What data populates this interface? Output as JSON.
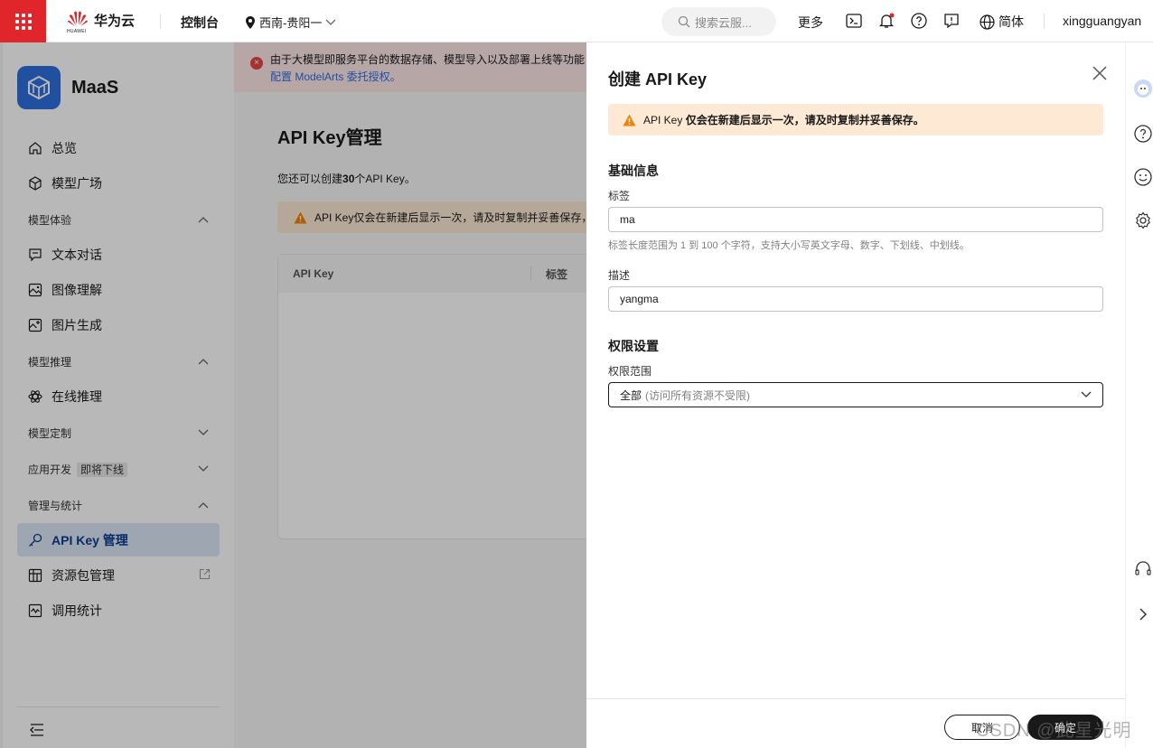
{
  "topbar": {
    "brand_name": "华为云",
    "brand_sub": "HUAWEI",
    "console": "控制台",
    "region": "西南-贵阳一",
    "search_placeholder": "搜索云服...",
    "more": "更多",
    "language": "简体",
    "username": "xingguangyan",
    "brand_color": "#e0262b"
  },
  "sidebar": {
    "product": "MaaS",
    "items_top": [
      {
        "label": "总览",
        "icon": "home-icon"
      },
      {
        "label": "模型广场",
        "icon": "model-cube-icon"
      }
    ],
    "group_experience": {
      "title": "模型体验",
      "items": [
        "文本对话",
        "图像理解",
        "图片生成"
      ]
    },
    "group_inference": {
      "title": "模型推理",
      "items": [
        "在线推理"
      ]
    },
    "group_custom": {
      "title": "模型定制"
    },
    "group_appdev": {
      "title": "应用开发",
      "tag": "即将下线"
    },
    "group_manage": {
      "title": "管理与统计",
      "items": [
        "API Key 管理",
        "资源包管理",
        "调用统计"
      ]
    }
  },
  "main": {
    "banner_text": "由于大模型即服务平台的数据存储、模型导入以及部署上线等功能",
    "banner_link": "配置 ModelArts 委托授权。",
    "page_title": "API Key管理",
    "remain_pre": "您还可以创建",
    "remain_count": "30",
    "remain_post": "个API Key。",
    "warn_text": "API Key仅会在新建后显示一次，请及时复制并妥善保存，",
    "table_headers": [
      "API Key",
      "标签"
    ]
  },
  "drawer": {
    "title": "创建 API Key",
    "warn_prefix": "API Key",
    "warn_bold": "仅会在新建后显示一次，请及时复制并妥善保存。",
    "section_basic": "基础信息",
    "label_tag": "标签",
    "value_tag": "ma",
    "hint_tag": "标签长度范围为 1 到 100 个字符，支持大小写英文字母、数字、下划线、中划线。",
    "label_desc": "描述",
    "value_desc": "yangma",
    "section_perm": "权限设置",
    "label_scope": "权限范围",
    "scope_value": "全部",
    "scope_sub": "(访问所有资源不受限)",
    "cancel": "取消",
    "confirm": "确定"
  },
  "watermark": "CSDN @此星光明"
}
